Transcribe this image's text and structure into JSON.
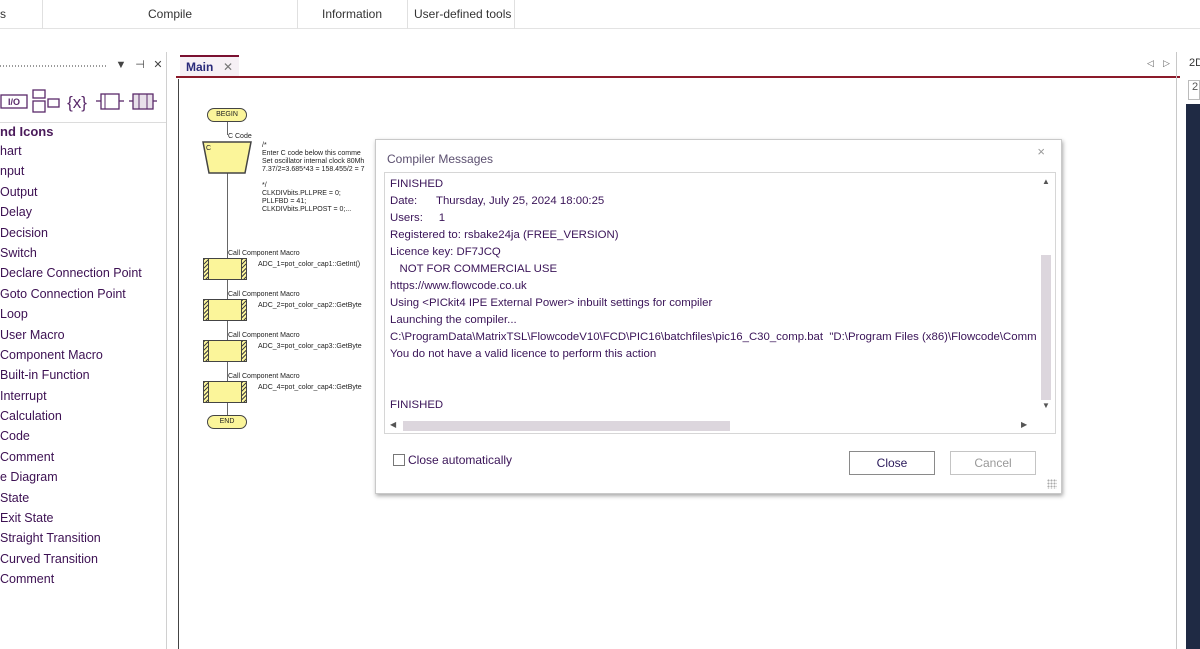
{
  "menubar": {
    "tabs": [
      "s",
      "Compile",
      "Information",
      "User-defined tools"
    ]
  },
  "left_panel": {
    "header_buttons": [
      "▼",
      "⊣",
      "✕"
    ],
    "toolbar_icons": [
      "io-icon",
      "component-icon",
      "variables-icon",
      "ports-icon",
      "chip-icon"
    ],
    "category_title": "nd Icons",
    "items": [
      "hart",
      "nput",
      "Output",
      "Delay",
      "Decision",
      "Switch",
      "Declare Connection Point",
      "Goto Connection Point",
      "Loop",
      "User Macro",
      "Component Macro",
      "Built-in Function",
      "Interrupt",
      "Calculation",
      "Code",
      "Comment",
      "e Diagram",
      "State",
      "Exit State",
      "Straight Transition",
      "Curved Transition",
      "Comment"
    ]
  },
  "editor": {
    "tab_label": "Main",
    "tab_close": "✕",
    "nav_left": "◁",
    "nav_right": "▷",
    "right_panel_label": "2D",
    "right_panel_box": "2"
  },
  "flowchart": {
    "begin": "BEGIN",
    "end": "END",
    "code_label": "C Code",
    "code_box": "C",
    "code_text": [
      "/*",
      "   Enter C code below this comme",
      "   Set oscillator internal clock 80Mh",
      "   7.37/2=3.685*43 = 158.455/2 = 7",
      "",
      "*/",
      "CLKDIVbits.PLLPRE = 0;",
      "PLLFBD = 41;",
      "CLKDIVbits.PLLPOST = 0;..."
    ],
    "macros": [
      {
        "label": "Call Component Macro",
        "text": "ADC_1=pot_color_cap1::GetInt()"
      },
      {
        "label": "Call Component Macro",
        "text": "ADC_2=pot_color_cap2::GetByte"
      },
      {
        "label": "Call Component Macro",
        "text": "ADC_3=pot_color_cap3::GetByte"
      },
      {
        "label": "Call Component Macro",
        "text": "ADC_4=pot_color_cap4::GetByte"
      }
    ]
  },
  "dialog": {
    "title": "Compiler Messages",
    "close_glyph": "×",
    "messages": [
      "FINISHED",
      "Date:      Thursday, July 25, 2024 18:00:25",
      "Users:     1",
      "Registered to: rsbake24ja (FREE_VERSION)",
      "Licence key: DF7JCQ",
      "   NOT FOR COMMERCIAL USE",
      "https://www.flowcode.co.uk",
      "Using <PICkit4 IPE External Power> inbuilt settings for compiler",
      "Launching the compiler...",
      "C:\\ProgramData\\MatrixTSL\\FlowcodeV10\\FCD\\PIC16\\batchfiles\\pic16_C30_comp.bat  \"D:\\Program Files (x86)\\Flowcode\\Comm",
      "You do not have a valid licence to perform this action",
      "",
      "",
      "FINISHED"
    ],
    "close_auto_label": "Close automatically",
    "close_auto_checked": false,
    "buttons": {
      "close": "Close",
      "cancel": "Cancel"
    }
  }
}
